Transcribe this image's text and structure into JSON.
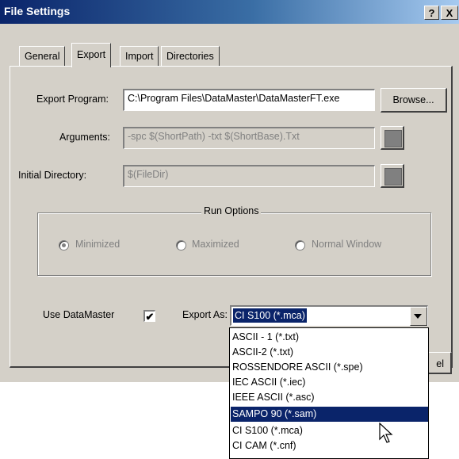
{
  "window": {
    "title": "File Settings",
    "help_label": "?",
    "close_label": "X"
  },
  "tabs": [
    {
      "label": "General"
    },
    {
      "label": "Export"
    },
    {
      "label": "Import"
    },
    {
      "label": "Directories"
    }
  ],
  "export": {
    "program_label": "Export Program:",
    "program_value": "C:\\Program Files\\DataMaster\\DataMasterFT.exe",
    "browse_label": "Browse...",
    "arguments_label": "Arguments:",
    "arguments_value": "-spc $(ShortPath) -txt $(ShortBase).Txt",
    "initdir_label": "Initial Directory:",
    "initdir_value": "$(FileDir)"
  },
  "run_options": {
    "title": "Run Options",
    "options": [
      "Minimized",
      "Maximized",
      "Normal Window"
    ],
    "selected": "Minimized"
  },
  "use_datamaster": {
    "label": "Use DataMaster",
    "checked": true,
    "check_glyph": "✔"
  },
  "export_as": {
    "label": "Export As:",
    "selected": "CI S100 (*.mca)",
    "options": [
      "ASCII - 1 (*.txt)",
      "ASCII-2 (*.txt)",
      "ROSSENDORE ASCII (*.spe)",
      "IEC ASCII (*.iec)",
      "IEEE ASCII (*.asc)",
      "SAMPO 90 (*.sam)",
      "CI S100 (*.mca)",
      "CI CAM (*.cnf)"
    ],
    "highlighted": "SAMPO 90 (*.sam)"
  },
  "bottom": {
    "partial_cancel_label": "el"
  },
  "colors": {
    "selection": "#0a246a",
    "face": "#d4d0c8",
    "disabled_text": "#808080"
  },
  "icons": {
    "cursor": "mouse-pointer-icon"
  }
}
